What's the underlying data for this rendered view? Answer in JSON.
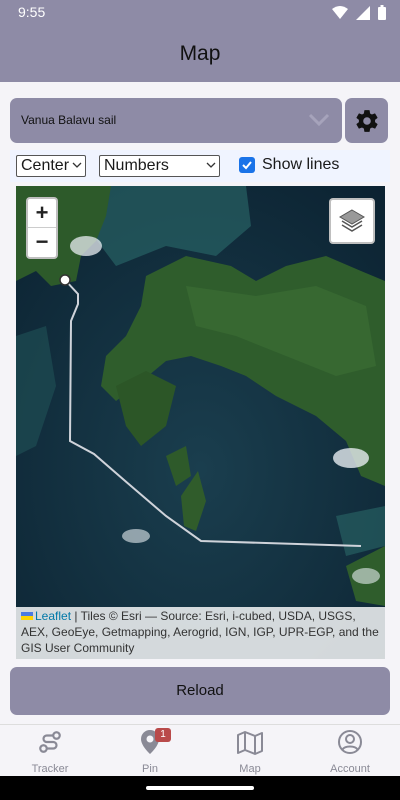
{
  "status_bar": {
    "time": "9:55"
  },
  "app_bar": {
    "title": "Map"
  },
  "route_select": {
    "value": "Vanua Balavu sail"
  },
  "controls": {
    "center_select": "Center",
    "label_select": "Numbers",
    "show_lines_label": "Show lines",
    "show_lines_checked": true
  },
  "map": {
    "zoom_in": "+",
    "zoom_out": "−",
    "attribution": {
      "leaflet": "Leaflet",
      "text": " | Tiles © Esri — Source: Esri, i-cubed, USDA, USGS, AEX, GeoEye, Getmapping, Aerogrid, IGN, IGP, UPR-EGP, and the GIS User Community"
    }
  },
  "reload_button": "Reload",
  "bottom_nav": {
    "tracker": "Tracker",
    "pin": "Pin",
    "pin_badge": "1",
    "map": "Map",
    "account": "Account"
  },
  "colors": {
    "accent": "#8e8ba6",
    "checkbox": "#1a73e8",
    "badge": "#b94a4a"
  }
}
